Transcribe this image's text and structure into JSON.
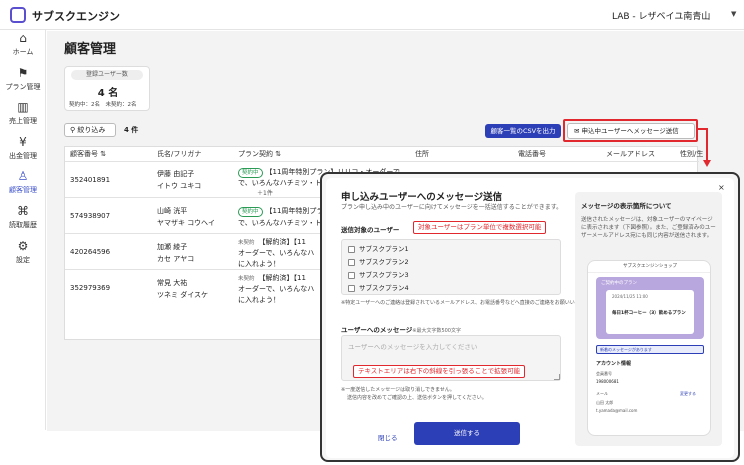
{
  "header": {
    "brand": "サブスクエンジン",
    "store": "LAB - レザベイユ南青山",
    "store_chevron": "▼"
  },
  "sidebar": {
    "items": [
      {
        "icon": "⌂",
        "label": "ホーム"
      },
      {
        "icon": "⚑",
        "label": "プラン管理"
      },
      {
        "icon": "▥",
        "label": "売上管理"
      },
      {
        "icon": "¥",
        "label": "出金管理"
      },
      {
        "icon": "♙",
        "label": "顧客管理"
      },
      {
        "icon": "⌘",
        "label": "読取履歴"
      },
      {
        "icon": "⚙",
        "label": "設定"
      }
    ]
  },
  "page": {
    "title": "顧客管理",
    "count_label": "登録ユーザー数",
    "count_value": "4 名",
    "count_sub": "契約中：2名　未契約：2名",
    "filter_label": "絞り込み",
    "filter_icon": "⚲",
    "filter_count": "4 件",
    "csv_button": "顧客一覧のCSVを出力",
    "message_icon": "✉",
    "message_button": "申込中ユーザーへメッセージ送信"
  },
  "table": {
    "headers": [
      "顧客番号 ⇅",
      "氏名/フリガナ",
      "プラン契約 ⇅",
      "住所",
      "電話番号",
      "メールアドレス",
      "性別/生"
    ],
    "rows": [
      {
        "id": "352401891",
        "name": "伊藤 由記子",
        "kana": "イトウ ユキコ",
        "status": "契約中",
        "plan": "【11周年特別プラン】リリコ・オーダーで",
        "plan2": "で、いろんなハチミツ・ト",
        "extra": "＋1件"
      },
      {
        "id": "574938907",
        "name": "山崎 洸平",
        "kana": "ヤマザキ コウヘイ",
        "status": "契約中",
        "plan": "【11周年特別プラン】",
        "plan2": "で、いろんなハチミツ・ト",
        "extra": ""
      },
      {
        "id": "420264596",
        "name": "加瀬 綾子",
        "kana": "カセ アヤコ",
        "status": "未契約",
        "plan": "【解約済】【11",
        "plan2": "オーダーで、いろんなハ",
        "plan3": "に入れよう！"
      },
      {
        "id": "352979369",
        "name": "常見 大祐",
        "kana": "ツネミ ダイスケ",
        "status": "未契約",
        "plan": "【解約済】【11",
        "plan2": "オーダーで、いろんなハ",
        "plan3": "に入れよう！"
      }
    ]
  },
  "modal": {
    "title": "申し込みユーザーへのメッセージ送信",
    "subtitle": "プラン申し込み中のユーザーに向けてメッセージを一括送信することができます。",
    "close": "×",
    "target_label": "送信対象のユーザー",
    "target_annotation": "対象ユーザーはプラン単位で複数選択可能",
    "plans": [
      "サブスクプラン1",
      "サブスクプラン2",
      "サブスクプラン3",
      "サブスクプラン4"
    ],
    "note": "※特定ユーザーへのご連絡は登録されているメールアドレス、お電話番号などへ直接のご連絡をお願いいたします。",
    "message_label": "ユーザーへのメッセージ",
    "message_hint": "※最大文字数500文字",
    "message_placeholder": "ユーザーへのメッセージを入力してください",
    "textarea_annotation": "テキストエリアは右下の斜線を引っ張ることで拡張可能",
    "note2_line1": "※一度送信したメッセージは取り消しできません。",
    "note2_line2": "送信内容を改めてご確認の上、送信ボタンを押してください。",
    "close_button": "閉じる",
    "send_button": "送信する",
    "preview": {
      "title": "メッセージの表示箇所について",
      "desc": "送信されたメッセージは、対象ユーザーのマイページに表示されます（下図参照）。また、ご登録済みのユーザーメールアドレス宛にも同じ内容が送信されます。",
      "app_header": "サブスクエンジンショップ",
      "card_label": "ご契約中のプラン",
      "card_date": "2024/11/25 11:00",
      "card_plan": "毎日1杯コーヒー（3）飲めるプラン",
      "msg_banner": "新着のメッセージがあります",
      "account": "アカウント情報",
      "member_label": "会員番号",
      "member_no": "198000681",
      "email_label": "メール",
      "email_link": "変更する",
      "name_val": "山田 太郎",
      "email_val": "t.yamada@mail.com"
    }
  }
}
